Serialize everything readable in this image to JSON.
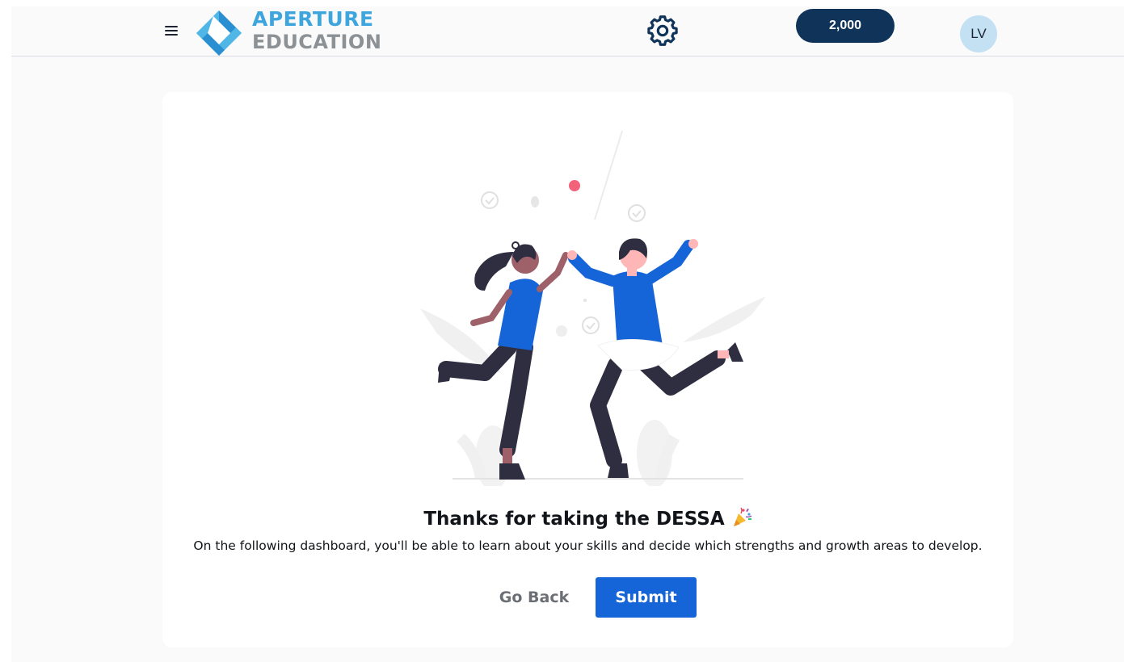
{
  "header": {
    "logo": {
      "line1": "APERTURE",
      "line2": "EDUCATION",
      "colors": {
        "line1": "#3ea6dd",
        "line2": "#8c9196"
      }
    },
    "menu_icon": "hamburger-menu-icon",
    "settings_icon": "gear-icon",
    "points": "2,000",
    "avatar_initials": "LV"
  },
  "main": {
    "illustration": "two-people-high-five-illustration",
    "title": "Thanks for taking the DESSA",
    "title_icon": "party-popper-icon",
    "subtitle": "On the following dashboard, you'll be able to learn about your skills and decide which strengths and growth areas to develop.",
    "buttons": {
      "back": "Go Back",
      "submit": "Submit"
    }
  },
  "colors": {
    "primary": "#1565d8",
    "pill": "#0f3359",
    "avatar_bg": "#c3e1f3",
    "page_bg": "#fafafa"
  }
}
